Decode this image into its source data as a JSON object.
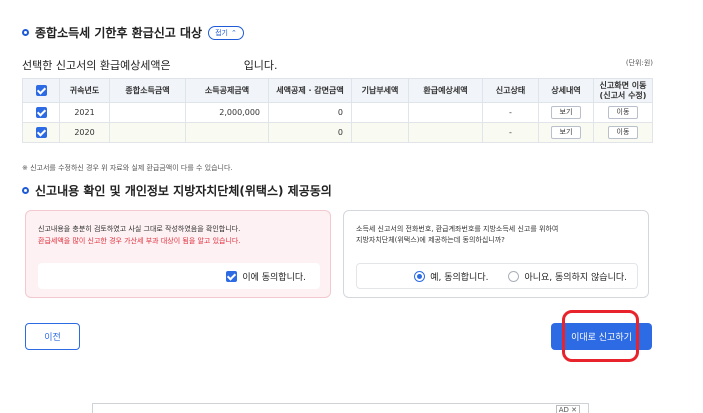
{
  "section1": {
    "title": "종합소득세 기한후 환급신고 대상",
    "fold_label": "접기"
  },
  "summary": {
    "prefix": "선택한 신고서의 환급예상세액은",
    "suffix": "입니다.",
    "unit": "(단위:원)"
  },
  "table": {
    "headers": [
      "귀속년도",
      "종합소득금액",
      "소득공제금액",
      "세액공제 · 감면금액",
      "기납부세액",
      "환급예상세액",
      "신고상태",
      "상세내역",
      "신고화면 이동\n(신고서 수정)"
    ],
    "rows": [
      {
        "year": "2021",
        "income": "",
        "deduction": "2,000,000",
        "credit": "0",
        "prepaid": "",
        "refund": "",
        "status": "-",
        "detail": "보기",
        "move": "이동"
      },
      {
        "year": "2020",
        "income": "",
        "deduction": "",
        "credit": "0",
        "prepaid": "",
        "refund": "",
        "status": "-",
        "detail": "보기",
        "move": "이동"
      }
    ]
  },
  "note": "※ 신고서를 수정하신 경우 위 자료와 실제 환급금액이 다를 수 있습니다.",
  "section2": {
    "title": "신고내용 확인 및 개인정보 지방자치단체(위택스) 제공동의"
  },
  "confirm_box": {
    "line1": "신고내용을 충분히 검토하였고 사실 그대로 작성하였음을 확인합니다.",
    "line2": "환급세액을 많이 신고한 경우 가산세 부과 대상이 됨을 알고 있습니다.",
    "agree_label": "이에 동의합니다."
  },
  "consent_box": {
    "line1": "소득세 신고서의 전화번호, 환급계좌번호를 지방소득세 신고를 위하여",
    "line2": "지방자치단체(위택스)에 제공하는데 동의하십니까?",
    "yes_label": "예, 동의합니다.",
    "no_label": "아니요, 동의하지 않습니다."
  },
  "buttons": {
    "prev": "이전",
    "submit": "이대로 신고하기"
  },
  "ad": {
    "tag": "AD ✕"
  }
}
